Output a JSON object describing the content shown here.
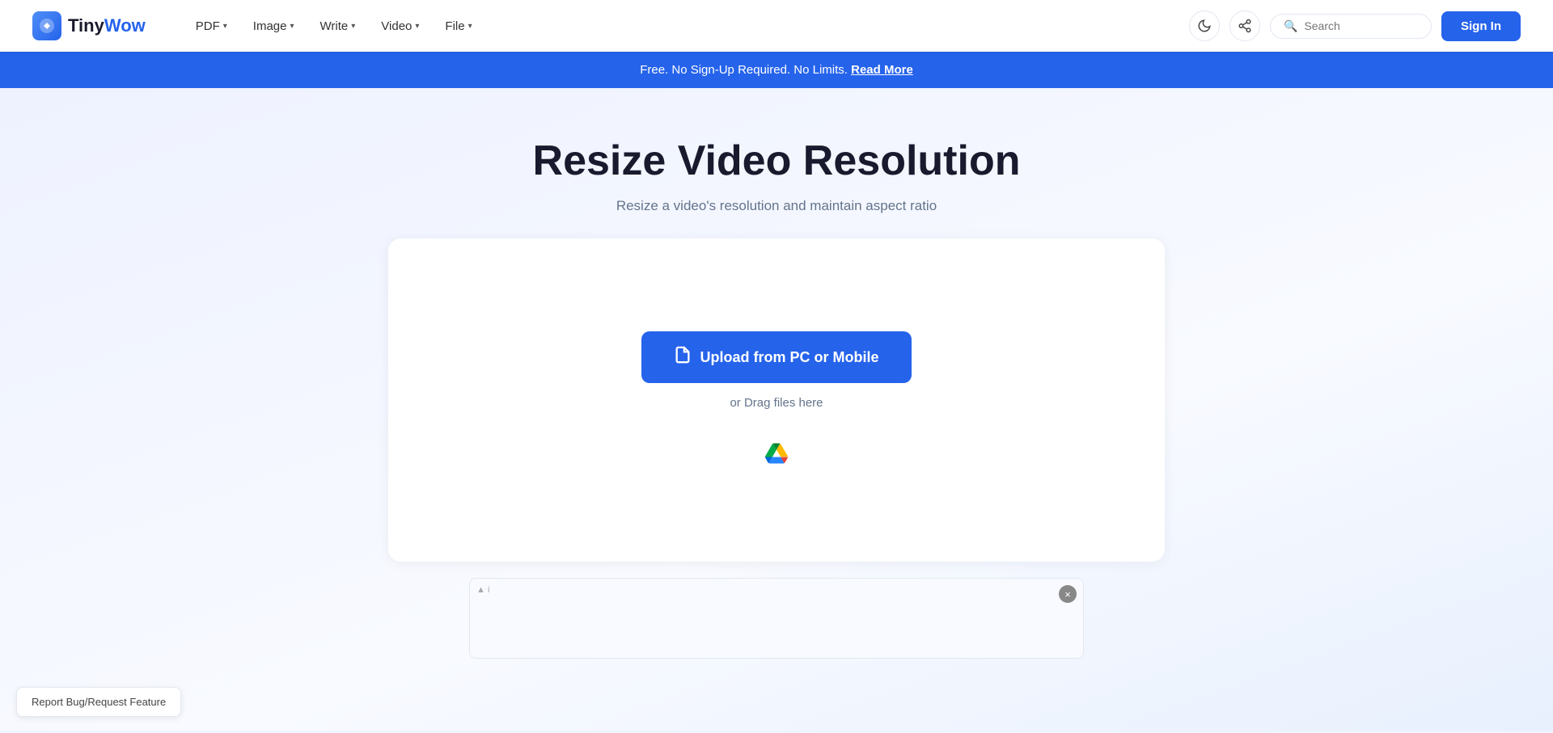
{
  "logo": {
    "tiny": "Tiny",
    "wow": "Wow"
  },
  "nav": {
    "items": [
      {
        "label": "PDF",
        "hasDropdown": true
      },
      {
        "label": "Image",
        "hasDropdown": true
      },
      {
        "label": "Write",
        "hasDropdown": true
      },
      {
        "label": "Video",
        "hasDropdown": true
      },
      {
        "label": "File",
        "hasDropdown": true
      }
    ]
  },
  "search": {
    "placeholder": "Search"
  },
  "signin": {
    "label": "Sign In"
  },
  "banner": {
    "text": "Free. No Sign-Up Required. No Limits.",
    "link_label": "Read More"
  },
  "hero": {
    "title": "Resize Video Resolution",
    "subtitle": "Resize a video's resolution and maintain aspect ratio"
  },
  "upload": {
    "button_label": "Upload from PC or Mobile",
    "drag_text": "or Drag files here"
  },
  "bug_report": {
    "label": "Report Bug/Request Feature"
  }
}
